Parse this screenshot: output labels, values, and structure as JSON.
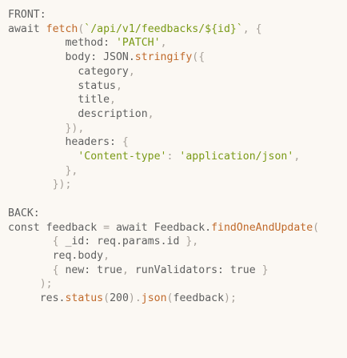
{
  "code": {
    "lines": [
      {
        "tokens": [
          {
            "t": "FRONT:",
            "k": "label"
          }
        ]
      },
      {
        "tokens": [
          {
            "t": "await ",
            "k": "keyword"
          },
          {
            "t": "fetch",
            "k": "function"
          },
          {
            "t": "(",
            "k": "punct"
          },
          {
            "t": "`/api/v1/feedbacks/${id}`",
            "k": "string"
          },
          {
            "t": ", {",
            "k": "punct"
          }
        ]
      },
      {
        "tokens": [
          {
            "t": "         method: ",
            "k": "attr"
          },
          {
            "t": "'PATCH'",
            "k": "string"
          },
          {
            "t": ",",
            "k": "punct"
          }
        ]
      },
      {
        "tokens": [
          {
            "t": "         body: ",
            "k": "attr"
          },
          {
            "t": "JSON.",
            "k": "keyword"
          },
          {
            "t": "stringify",
            "k": "function"
          },
          {
            "t": "({",
            "k": "punct"
          }
        ]
      },
      {
        "tokens": [
          {
            "t": "           category",
            "k": "attr"
          },
          {
            "t": ",",
            "k": "punct"
          }
        ]
      },
      {
        "tokens": [
          {
            "t": "           status",
            "k": "attr"
          },
          {
            "t": ",",
            "k": "punct"
          }
        ]
      },
      {
        "tokens": [
          {
            "t": "           title",
            "k": "attr"
          },
          {
            "t": ",",
            "k": "punct"
          }
        ]
      },
      {
        "tokens": [
          {
            "t": "           description",
            "k": "attr"
          },
          {
            "t": ",",
            "k": "punct"
          }
        ]
      },
      {
        "tokens": [
          {
            "t": "         }),",
            "k": "punct"
          }
        ]
      },
      {
        "tokens": [
          {
            "t": "         headers: ",
            "k": "attr"
          },
          {
            "t": "{",
            "k": "punct"
          }
        ]
      },
      {
        "tokens": [
          {
            "t": "           'Content-type'",
            "k": "string"
          },
          {
            "t": ": ",
            "k": "punct"
          },
          {
            "t": "'application/json'",
            "k": "string"
          },
          {
            "t": ",",
            "k": "punct"
          }
        ]
      },
      {
        "tokens": [
          {
            "t": "         },",
            "k": "punct"
          }
        ]
      },
      {
        "tokens": [
          {
            "t": "       });",
            "k": "punct"
          }
        ]
      },
      {
        "tokens": []
      },
      {
        "tokens": [
          {
            "t": "BACK:",
            "k": "label"
          }
        ]
      },
      {
        "tokens": [
          {
            "t": "const ",
            "k": "keyword"
          },
          {
            "t": "feedback ",
            "k": "attr"
          },
          {
            "t": "= ",
            "k": "punct"
          },
          {
            "t": "await ",
            "k": "keyword"
          },
          {
            "t": "Feedback.",
            "k": "attr"
          },
          {
            "t": "findOneAndUpdate",
            "k": "function"
          },
          {
            "t": "(",
            "k": "punct"
          }
        ]
      },
      {
        "tokens": [
          {
            "t": "       { ",
            "k": "punct"
          },
          {
            "t": "_id: ",
            "k": "attr"
          },
          {
            "t": "req.params.id ",
            "k": "attr"
          },
          {
            "t": "},",
            "k": "punct"
          }
        ]
      },
      {
        "tokens": [
          {
            "t": "       req.body",
            "k": "attr"
          },
          {
            "t": ",",
            "k": "punct"
          }
        ]
      },
      {
        "tokens": [
          {
            "t": "       { ",
            "k": "punct"
          },
          {
            "t": "new: ",
            "k": "attr"
          },
          {
            "t": "true",
            "k": "literal"
          },
          {
            "t": ", ",
            "k": "punct"
          },
          {
            "t": "runValidators: ",
            "k": "attr"
          },
          {
            "t": "true ",
            "k": "literal"
          },
          {
            "t": "}",
            "k": "punct"
          }
        ]
      },
      {
        "tokens": [
          {
            "t": "     );",
            "k": "punct"
          }
        ]
      },
      {
        "tokens": [
          {
            "t": "     res.",
            "k": "attr"
          },
          {
            "t": "status",
            "k": "function"
          },
          {
            "t": "(",
            "k": "punct"
          },
          {
            "t": "200",
            "k": "number"
          },
          {
            "t": ").",
            "k": "punct"
          },
          {
            "t": "json",
            "k": "function"
          },
          {
            "t": "(",
            "k": "punct"
          },
          {
            "t": "feedback",
            "k": "attr"
          },
          {
            "t": ");",
            "k": "punct"
          }
        ]
      }
    ]
  },
  "colors": {
    "background": "#fbf8f3",
    "text": "#5f6060",
    "string": "#7a9a16",
    "function": "#c06a2b",
    "punctuation": "#a7a19a"
  }
}
